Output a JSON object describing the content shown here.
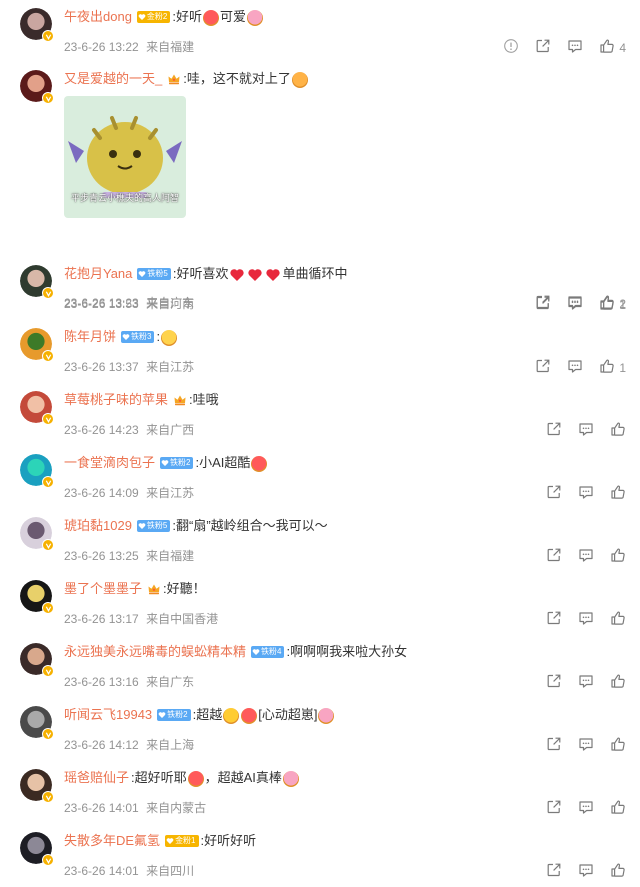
{
  "comments": [
    {
      "username": "午夜出dong",
      "fan_badge": {
        "label": "金粉2",
        "style": "gold"
      },
      "crown": false,
      "text_parts": [
        ":好听",
        "{emo}",
        "可爱",
        "{emo}"
      ],
      "date": "23-6-26 13:22",
      "location": "来自福建",
      "has_report": true,
      "likes": "4"
    },
    {
      "username": "又是爱越的一天_",
      "fan_badge": null,
      "crown": true,
      "text_parts": [
        ":哇，这不就对上了",
        "{emo}"
      ],
      "date": "23-6-26 13:23",
      "location": "来自广东",
      "sticker_caption": "平步青云小樵夫的高人阿智",
      "likes": "2"
    },
    {
      "username": "花抱月Yana",
      "fan_badge": {
        "label": "铁粉5",
        "style": "blue"
      },
      "crown": false,
      "text_parts": [
        ":好听喜欢",
        "{heart}",
        "{heart}",
        "{heart}",
        "单曲循环中"
      ],
      "date": "23-6-26 13:53",
      "location": "来自河南",
      "likes": "1"
    },
    {
      "username": "陈年月饼",
      "fan_badge": {
        "label": "铁粉3",
        "style": "blue"
      },
      "crown": false,
      "text_parts": [
        ":",
        "{emo}"
      ],
      "date": "23-6-26 13:37",
      "location": "来自江苏",
      "likes": "1"
    },
    {
      "username": "草莓桃子味的苹果",
      "fan_badge": null,
      "crown": true,
      "text_parts": [
        ":哇哦"
      ],
      "date": "23-6-26 14:23",
      "location": "来自广西",
      "likes": ""
    },
    {
      "username": "一食堂滴肉包子",
      "fan_badge": {
        "label": "铁粉2",
        "style": "blue"
      },
      "crown": false,
      "text_parts": [
        ":小AI超酷",
        "{emo}"
      ],
      "date": "23-6-26 14:09",
      "location": "来自江苏",
      "likes": ""
    },
    {
      "username": "琥珀黏1029",
      "fan_badge": {
        "label": "铁粉5",
        "style": "blue"
      },
      "crown": false,
      "text_parts": [
        ":翻“扇”越岭组合～我可以～"
      ],
      "date": "23-6-26 13:25",
      "location": "来自福建",
      "likes": ""
    },
    {
      "username": "墨了个墨墨子",
      "fan_badge": null,
      "crown": true,
      "text_parts": [
        ":好聽！"
      ],
      "date": "23-6-26 13:17",
      "location": "来自中国香港",
      "likes": ""
    },
    {
      "username": "永远独美永远嘴毒的蜈蚣精本精",
      "fan_badge": {
        "label": "铁粉4",
        "style": "blue"
      },
      "crown": false,
      "text_parts": [
        ":啊啊啊我来啦大孙女"
      ],
      "date": "23-6-26 13:16",
      "location": "来自广东",
      "likes": ""
    },
    {
      "username": "听闻云飞19943",
      "fan_badge": {
        "label": "铁粉2",
        "style": "blue"
      },
      "crown": false,
      "text_parts": [
        ":超越",
        "{emo}",
        "{emo}",
        "[心动超崽]",
        "{emo}"
      ],
      "date": "23-6-26 14:12",
      "location": "来自上海",
      "likes": ""
    },
    {
      "username": "瑶爸赔仙子",
      "fan_badge": null,
      "crown": false,
      "text_parts": [
        ":超好听耶",
        "{emo}",
        "，超越AI真棒",
        "{emo}"
      ],
      "date": "23-6-26 14:01",
      "location": "来自内蒙古",
      "likes": ""
    },
    {
      "username": "失散多年DE氟氢",
      "fan_badge": {
        "label": "金粉1",
        "style": "gold"
      },
      "crown": false,
      "text_parts": [
        ":好听好听"
      ],
      "date": "23-6-26 14:01",
      "location": "来自四川",
      "likes": ""
    }
  ],
  "colors": {
    "username": "#eb7350",
    "meta": "#939393",
    "gold_badge": "#f7b500",
    "blue_badge": "#5aa9f4",
    "verified": "#f6b100"
  },
  "icons": {
    "report": "report-icon",
    "share": "share-icon",
    "comment": "comment-icon",
    "like": "thumbs-up-icon"
  }
}
